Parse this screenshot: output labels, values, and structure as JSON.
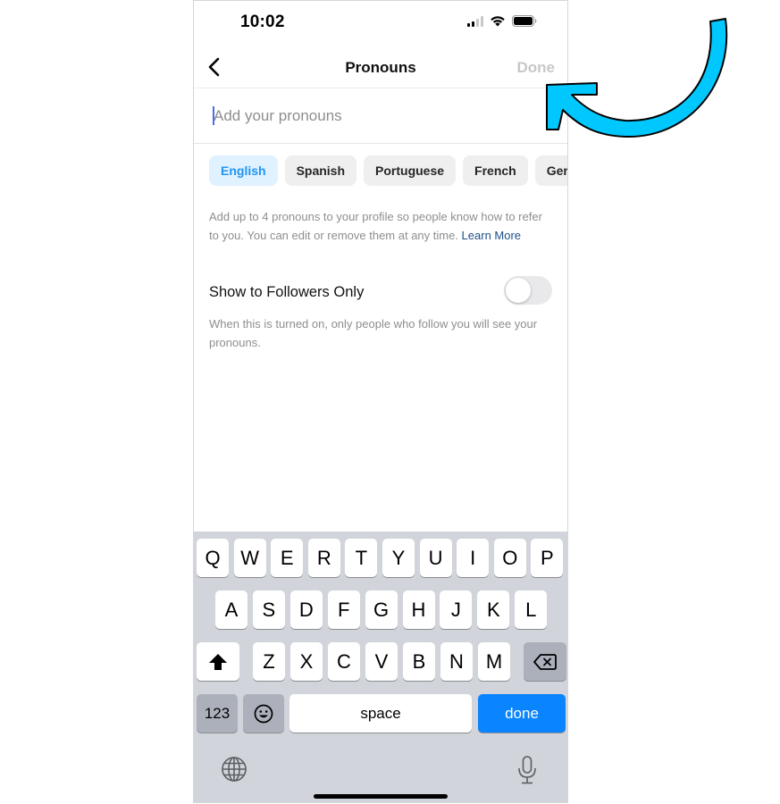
{
  "status_bar": {
    "time": "10:02",
    "signal_bars_active": 2,
    "signal_bars_total": 4,
    "icons": [
      "cellular-signal-icon",
      "wifi-icon",
      "battery-icon"
    ]
  },
  "nav": {
    "back_icon": "chevron-left-icon",
    "title": "Pronouns",
    "done_label": "Done"
  },
  "input": {
    "value": "",
    "placeholder": "Add your pronouns"
  },
  "languages": {
    "selected": "English",
    "items": [
      "English",
      "Spanish",
      "Portuguese",
      "French",
      "Germa"
    ]
  },
  "description": {
    "text": "Add up to 4 pronouns to your profile so people know how to refer to you. You can edit or remove them at any time. ",
    "link": "Learn More"
  },
  "followers_only": {
    "label": "Show to Followers Only",
    "enabled": false,
    "description": "When this is turned on, only people who follow you will see your pronouns."
  },
  "keyboard": {
    "row1": [
      "Q",
      "W",
      "E",
      "R",
      "T",
      "Y",
      "U",
      "I",
      "O",
      "P"
    ],
    "row2": [
      "A",
      "S",
      "D",
      "F",
      "G",
      "H",
      "J",
      "K",
      "L"
    ],
    "row3": [
      "Z",
      "X",
      "C",
      "V",
      "B",
      "N",
      "M"
    ],
    "numbers_label": "123",
    "space_label": "space",
    "done_label": "done",
    "icons": [
      "shift-icon",
      "delete-icon",
      "emoji-icon",
      "globe-icon",
      "microphone-icon"
    ]
  },
  "annotation": {
    "icon": "curved-arrow-icon",
    "color": "#00c8ff"
  }
}
